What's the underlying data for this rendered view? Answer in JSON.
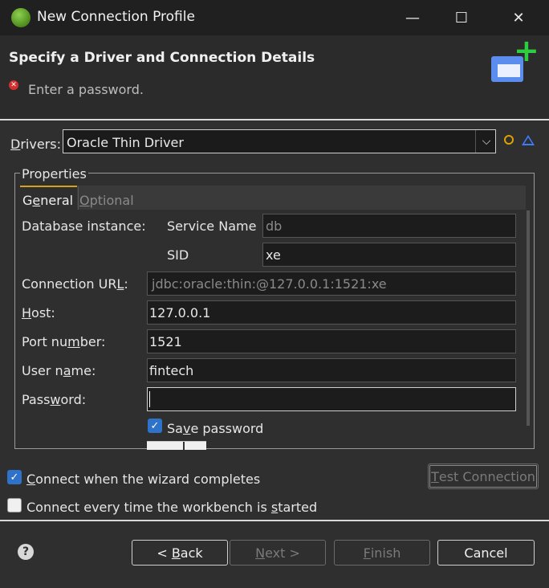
{
  "window": {
    "title": "New Connection Profile",
    "controls": {
      "minimize": "—",
      "maximize": "☐",
      "close": "✕"
    }
  },
  "header": {
    "title": "Specify a Driver and Connection Details",
    "message": "Enter a password.",
    "error_icon": "✕"
  },
  "drivers": {
    "label_pre": "",
    "label_mnemonic": "D",
    "label_post": "rivers:",
    "selected": "Oracle Thin Driver",
    "arrow": "⌵"
  },
  "properties": {
    "group_title": "Properties",
    "tabs": [
      {
        "pre": "G",
        "mnemonic": "e",
        "post": "neral"
      },
      {
        "pre": "",
        "mnemonic": "O",
        "post": "ptional"
      }
    ],
    "database_instance_label": "Database instance:",
    "service_name_label": "Service Name",
    "service_name_value": "db",
    "sid_label": "SID",
    "sid_value": "xe",
    "connection_url": {
      "pre": "Connection UR",
      "mnemonic": "L",
      "post": ":",
      "value": "jdbc:oracle:thin:@127.0.0.1:1521:xe"
    },
    "host": {
      "pre": "",
      "mnemonic": "H",
      "post": "ost:",
      "value": "127.0.0.1"
    },
    "port": {
      "pre": "Port nu",
      "mnemonic": "m",
      "post": "ber:",
      "value": "1521"
    },
    "user": {
      "pre": "User n",
      "mnemonic": "a",
      "post": "me:",
      "value": "fintech"
    },
    "password": {
      "pre": "Pass",
      "mnemonic": "w",
      "post": "ord:",
      "value": ""
    },
    "save_password": {
      "pre": "Sa",
      "mnemonic": "v",
      "post": "e password",
      "checked": "✓"
    }
  },
  "options": {
    "connect_on_complete": {
      "pre": "",
      "mnemonic": "C",
      "post": "onnect when the wizard completes",
      "checked": "✓"
    },
    "connect_every_time": {
      "pre": "Connect every time the workbench is ",
      "mnemonic": "s",
      "post": "tarted"
    },
    "test_connection": {
      "pre": "",
      "mnemonic": "T",
      "post": "est Connection"
    }
  },
  "footer": {
    "help": "?",
    "back": {
      "pre": "< ",
      "mnemonic": "B",
      "post": "ack"
    },
    "next": {
      "pre": "",
      "mnemonic": "N",
      "post": "ext >"
    },
    "finish": {
      "pre": "",
      "mnemonic": "F",
      "post": "inish"
    },
    "cancel": "Cancel"
  }
}
